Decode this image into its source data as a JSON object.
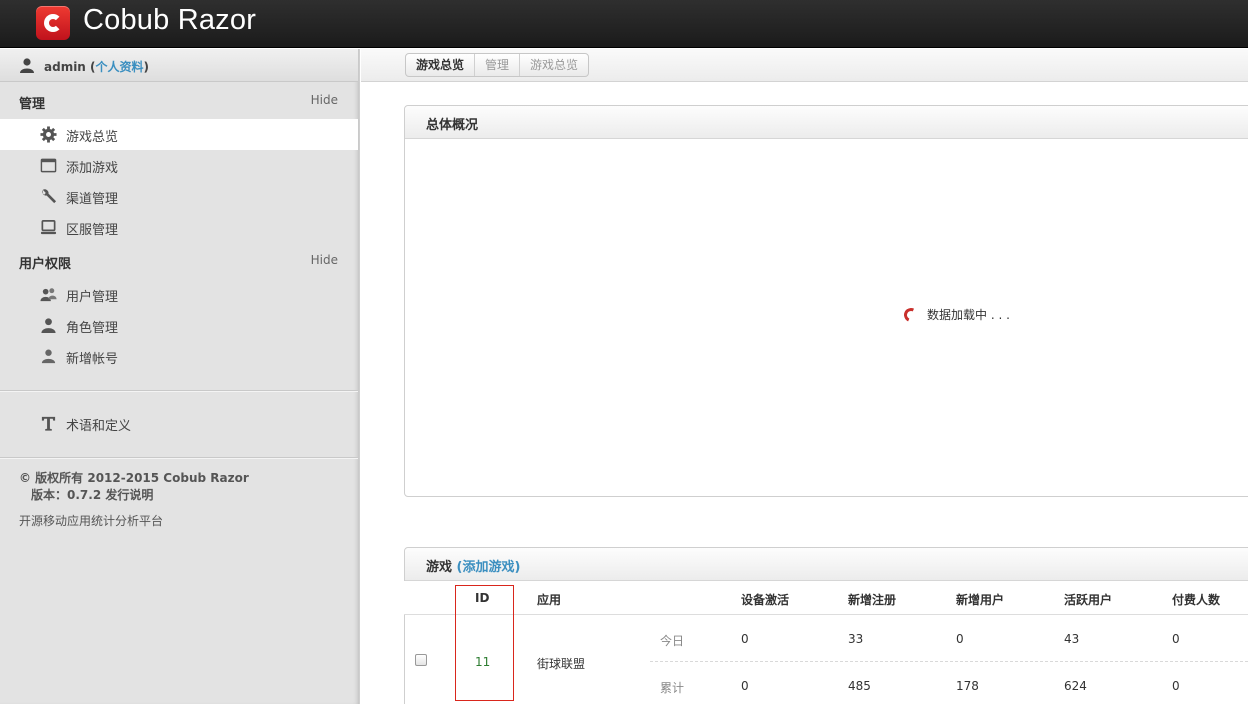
{
  "app": {
    "title": "Cobub Razor"
  },
  "user": {
    "name": "admin",
    "profile_link": "个人资料"
  },
  "sidebar": {
    "sections": [
      {
        "title": "管理",
        "toggle": "Hide",
        "items": [
          {
            "label": "游戏总览",
            "icon": "gear-icon",
            "active": true
          },
          {
            "label": "添加游戏",
            "icon": "window-icon"
          },
          {
            "label": "渠道管理",
            "icon": "wrench-icon"
          },
          {
            "label": "区服管理",
            "icon": "monitor-icon"
          }
        ]
      },
      {
        "title": "用户权限",
        "toggle": "Hide",
        "items": [
          {
            "label": "用户管理",
            "icon": "users-icon"
          },
          {
            "label": "角色管理",
            "icon": "user-role-icon"
          },
          {
            "label": "新增帐号",
            "icon": "user-add-icon"
          }
        ]
      }
    ],
    "glossary": {
      "label": "术语和定义",
      "icon": "text-icon"
    },
    "footer": {
      "copyright": "© 版权所有 2012-2015 Cobub Razor",
      "version_prefix": "版本：",
      "version": "0.7.2",
      "release_notes": "发行说明",
      "tagline": "开源移动应用统计分析平台"
    }
  },
  "breadcrumb": [
    "游戏总览",
    "管理",
    "游戏总览"
  ],
  "overview_panel": {
    "title": "总体概况",
    "loading_text": "数据加载中 . . ."
  },
  "games_panel": {
    "title": "游戏",
    "add_link": "(添加游戏)",
    "columns": [
      "ID",
      "应用",
      "设备激活",
      "新增注册",
      "新增用户",
      "活跃用户",
      "付费人数"
    ],
    "rows": [
      {
        "id": "11",
        "app": "街球联盟",
        "today": {
          "label": "今日",
          "values": [
            "0",
            "33",
            "0",
            "43",
            "0"
          ]
        },
        "total": {
          "label": "累计",
          "values": [
            "0",
            "485",
            "178",
            "624",
            "0"
          ]
        }
      }
    ]
  },
  "colors": {
    "accent_link": "#3b8fc0",
    "highlight_border": "#d9261c",
    "spinner": "#c9302c",
    "logo": "#e0261f"
  }
}
